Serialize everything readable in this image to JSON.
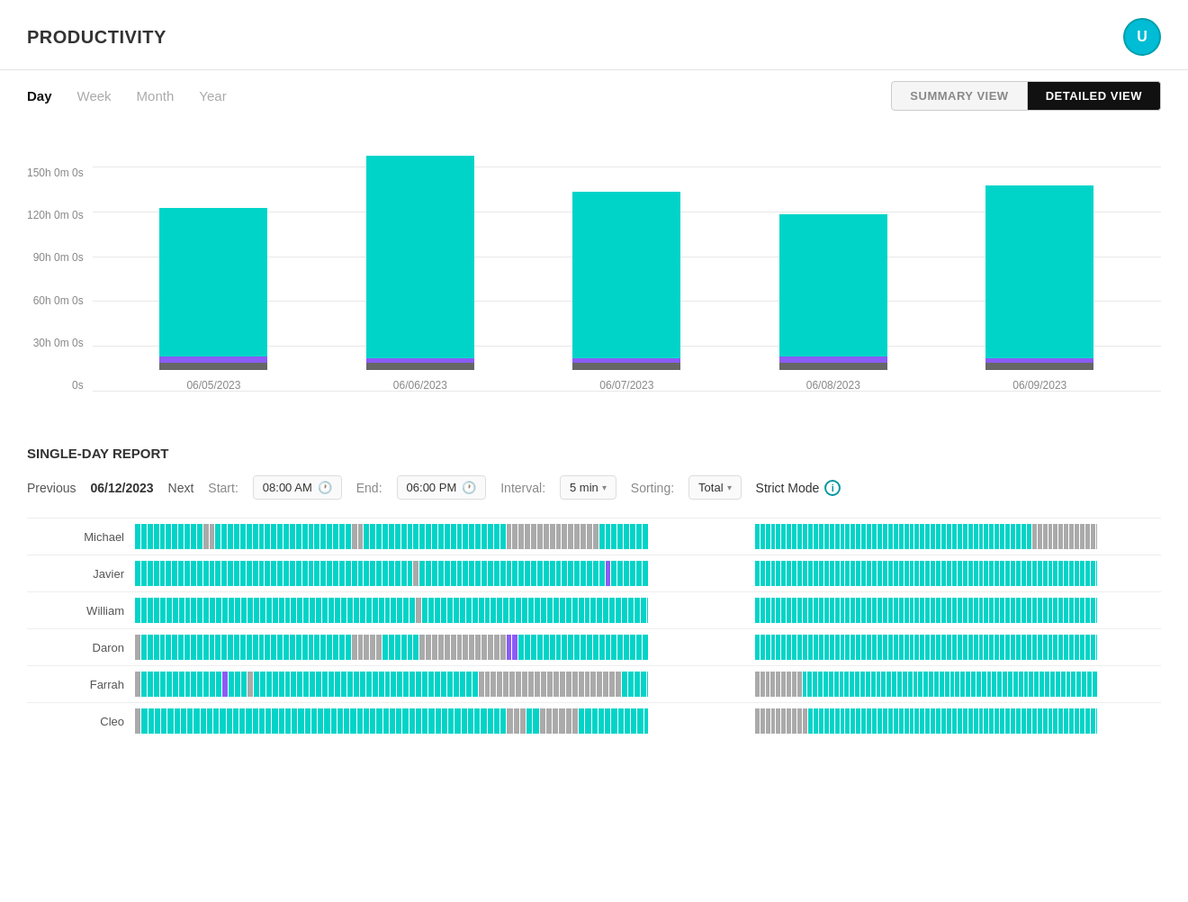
{
  "app": {
    "title": "PRODUCTIVITY",
    "avatar_letter": "U"
  },
  "tabs": {
    "items": [
      "Day",
      "Week",
      "Month",
      "Year"
    ],
    "active": "Day"
  },
  "views": {
    "summary": "SUMMARY VIEW",
    "detailed": "DETAILED VIEW",
    "active": "detailed"
  },
  "chart": {
    "y_labels": [
      "0s",
      "30h 0m 0s",
      "60h 0m 0s",
      "90h 0m 0s",
      "120h 0m 0s",
      "150h 0m 0s"
    ],
    "bars": [
      {
        "date": "06/05/2023",
        "teal_pct": 64,
        "purple_pct": 3
      },
      {
        "date": "06/06/2023",
        "teal_pct": 90,
        "purple_pct": 2
      },
      {
        "date": "06/07/2023",
        "teal_pct": 73,
        "purple_pct": 2
      },
      {
        "date": "06/08/2023",
        "teal_pct": 62,
        "purple_pct": 3
      },
      {
        "date": "06/09/2023",
        "teal_pct": 75,
        "purple_pct": 2
      }
    ]
  },
  "report": {
    "title": "SINGLE-DAY REPORT",
    "prev_label": "Previous",
    "date": "06/12/2023",
    "next_label": "Next",
    "start_label": "Start:",
    "start_value": "08:00 AM",
    "end_label": "End:",
    "end_value": "06:00 PM",
    "interval_label": "Interval:",
    "interval_value": "5 min",
    "sorting_label": "Sorting:",
    "sorting_value": "Total",
    "strict_mode_label": "Strict Mode"
  },
  "persons": [
    {
      "name": "Michael"
    },
    {
      "name": "Javier"
    },
    {
      "name": "William"
    },
    {
      "name": "Daron"
    },
    {
      "name": "Farrah"
    },
    {
      "name": "Cleo"
    }
  ]
}
